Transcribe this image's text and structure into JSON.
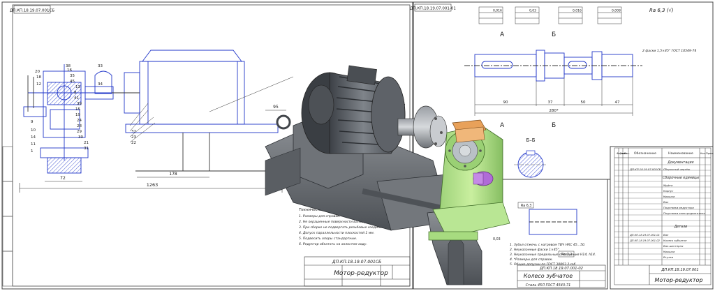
{
  "sheet1": {
    "code_tag": "ДП.КП.18.19.07.001СБ",
    "title_code": "ДП.КП.18.19.07.001СБ",
    "title_name": "Мотор-редуктор",
    "dim_bottom": "1263",
    "dim_mid": "178",
    "dim_left": "72",
    "dim_right": "95",
    "callouts": [
      "38",
      "16",
      "35",
      "45",
      "13",
      "8",
      "41",
      "39",
      "15",
      "19",
      "24",
      "28",
      "29",
      "30",
      "21",
      "31",
      "33",
      "34",
      "32",
      "23",
      "22",
      "20",
      "18",
      "12",
      "9",
      "10",
      "14",
      "11",
      "1"
    ],
    "notes_heading": "Технические требования",
    "notes": [
      "1. Размеры для справок.",
      "2. Не окрашенные поверхности валов установить 8 редуктор",
      "3. При сборке не подвергать резьбовые соединения",
      "4. Допуск параллельности плоскостей 1 мм.",
      "5. Подвесить опоры стандартные.",
      "6. Редуктор обкатать на холостом ходу."
    ]
  },
  "sheet2": {
    "code_tag": "ДП.КП.18.19.07.001-01",
    "roughness": "Ra 6,3 (√)",
    "dims": [
      "90",
      "37",
      "50",
      "47",
      "280*"
    ],
    "section_marks": [
      "А",
      "Б",
      "А",
      "Б"
    ],
    "note": "2 фаски 1,5×45° ГОСТ 10549-74",
    "frames": [
      "0,016",
      "0,03",
      "0,016",
      "0,008"
    ]
  },
  "sheet3": {
    "title_code": "ДП.КП.18.19.07.001-02",
    "title_name": "Колесо зубчатое",
    "material": "Сталь 45Л ГОСТ 4543-71",
    "section_label": "Б–Б",
    "frame_a": "0,05",
    "frame_b": "0,03",
    "roughness_a": "Ra 6,3",
    "roughness_b": "Ra 3,2",
    "requirements": [
      "1. Зубья отжечь с нагревом ТВЧ HRC 45...50.",
      "2. Неуказанные фаски 1×45°.",
      "3. Неуказанные предельные отклонения H14, h14.",
      "4. *Размеры для справок.",
      "5. Общие допуски по ГОСТ 30893.2-mK."
    ]
  },
  "sheet4": {
    "col_headers": [
      "Формат",
      "Зона",
      "Поз.",
      "Обозначение",
      "Наименование",
      "Кол.",
      "Прим."
    ],
    "section_docs": "Документация",
    "doc_row_code": "ДП.КП.18.19.07.001СБ",
    "doc_row_name": "Сборочный чертёж",
    "section_units": "Сборочные единицы",
    "units": [
      "Муфта",
      "Корпус",
      "Крышка",
      "Вал",
      "Подставка редуктора",
      "Подставка электродвигателя"
    ],
    "section_parts": "Детали",
    "parts": [
      {
        "code": "ДП.КП.18.19.07.001-01",
        "name": "Вал"
      },
      {
        "code": "ДП.КП.18.19.07.001-02",
        "name": "Колесо зубчатое"
      },
      {
        "code": "",
        "name": "Вал-шестерня"
      },
      {
        "code": "",
        "name": "Крышка"
      },
      {
        "code": "",
        "name": "Втулка"
      }
    ],
    "title_code": "ДП.КП.18.19.07.001",
    "title_name": "Мотор-редуктор"
  },
  "colors": {
    "line": "#1a1a1a",
    "blue": "#1f35c9",
    "motor_dark": "#555a60",
    "motor_light": "#8a8f95",
    "gearbox_green": "#b6e38c",
    "flange_orange": "#e8a15a",
    "shaft_purple": "#b06bd8"
  }
}
